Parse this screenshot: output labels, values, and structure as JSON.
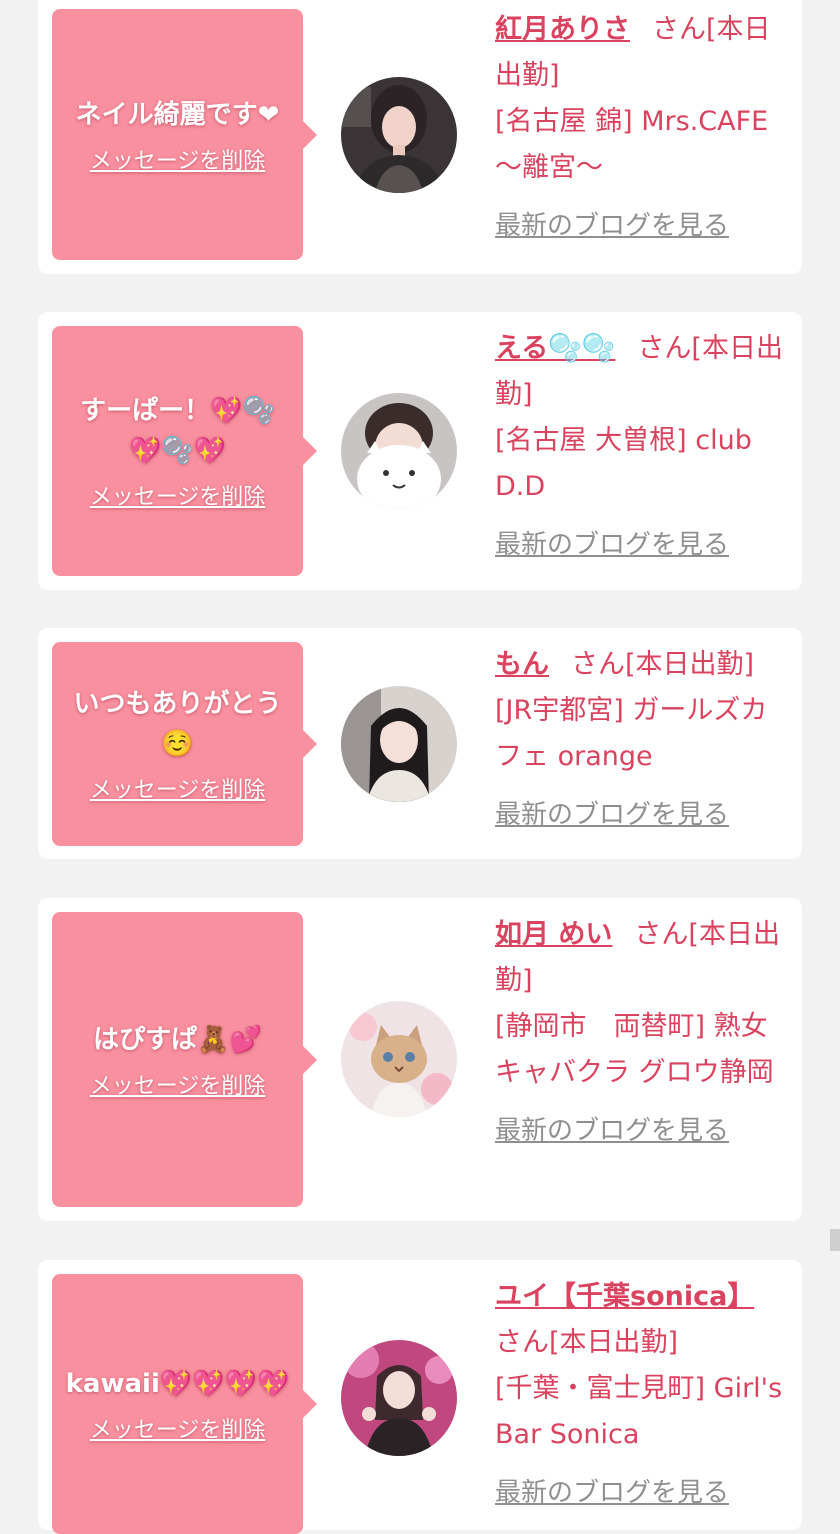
{
  "delete_label": "メッセージを削除",
  "blog_label": "最新のブログを見る",
  "accent_color": "#d9435f",
  "bubble_color": "#f9909f",
  "items": [
    {
      "message": "ネイル綺麗です❤",
      "name": "紅月ありさ",
      "suffix": "さん[本日出勤]",
      "shop": "[名古屋 錦] Mrs.CAFE 〜離宮〜",
      "avatar": "woman-portrait"
    },
    {
      "message": "すーぱー！💖🫧💖🫧💖",
      "name": "える🫧🫧",
      "suffix": "さん[本日出勤]",
      "shop": "[名古屋 大曽根] club D.D",
      "avatar": "cat-filter-selfie"
    },
    {
      "message": "いつもありがとう☺️",
      "name": "もん",
      "suffix": "さん[本日出勤]",
      "shop": "[JR宇都宮] ガールズカフェ orange",
      "avatar": "woman-long-black-hair"
    },
    {
      "message": "はぴすぱ🧸💕",
      "name": "如月 めい",
      "suffix": "さん[本日出勤]",
      "shop": "[静岡市　両替町] 熟女キャバクラ グロウ静岡",
      "avatar": "kitten-photo"
    },
    {
      "message": "kawaii💖💖💖💖",
      "name": "ユイ【千葉sonica】",
      "suffix": "さん[本日出勤]",
      "shop": "[千葉・富士見町] Girl's Bar Sonica",
      "avatar": "woman-pink-room"
    }
  ]
}
